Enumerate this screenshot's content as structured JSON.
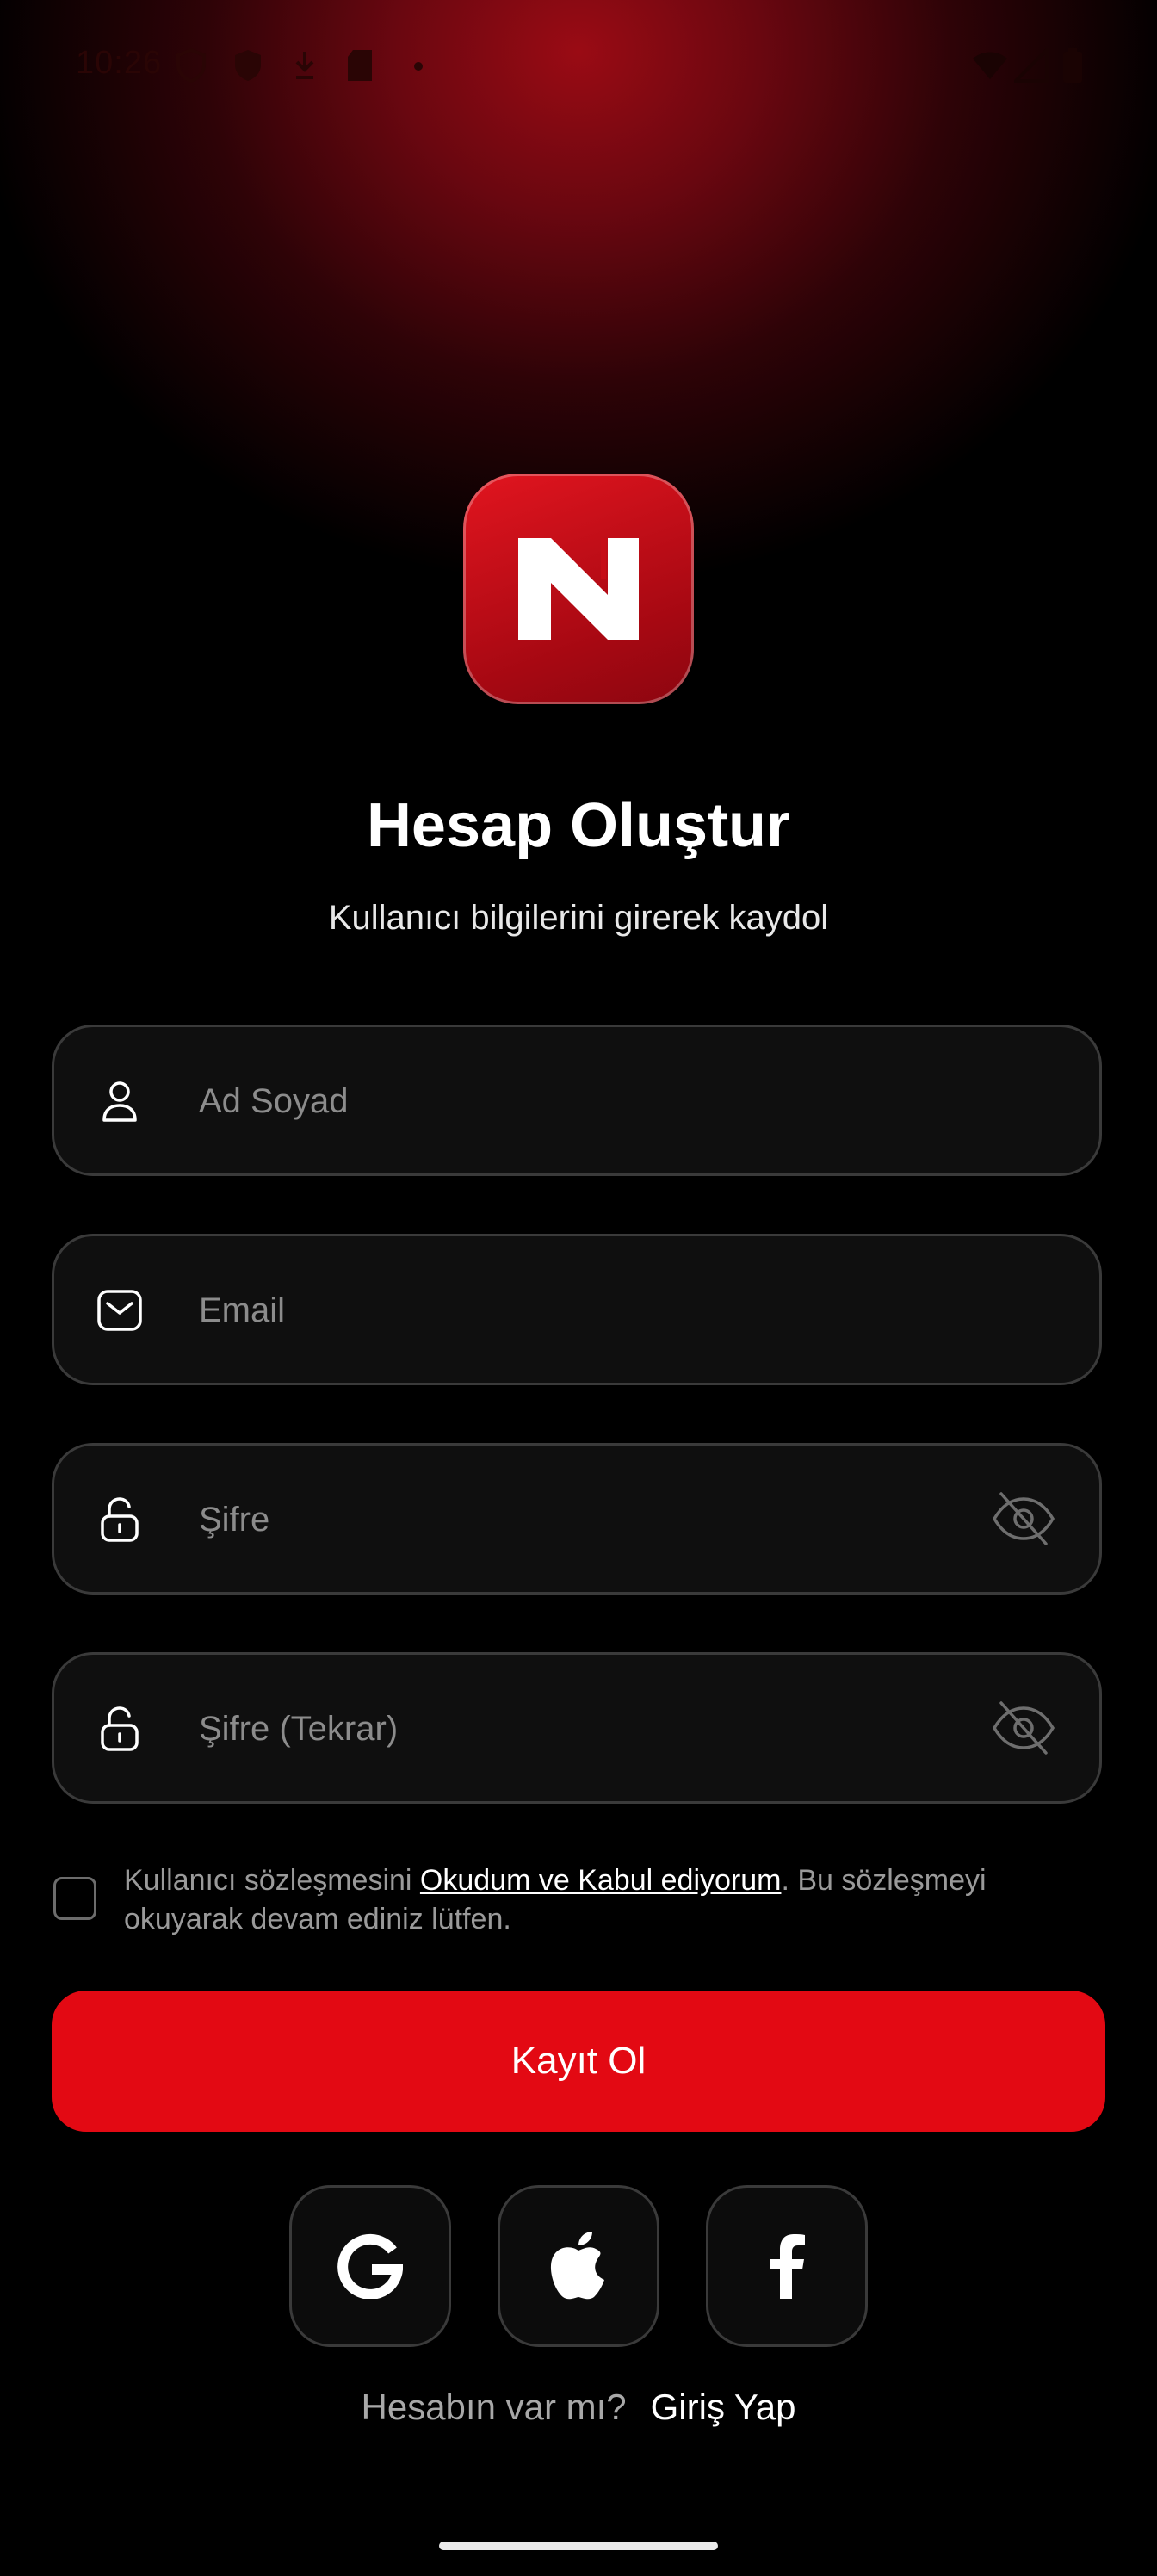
{
  "status_bar": {
    "time": "10:26",
    "icons": [
      "shield-icon",
      "vpn-icon",
      "download-icon",
      "sd-card-icon",
      "dot-icon",
      "wifi-icon",
      "signal-icon",
      "battery-icon"
    ]
  },
  "logo": {
    "icon": "brand-logo-icon",
    "accent": "#e30913"
  },
  "header": {
    "title": "Hesap Oluştur",
    "subtitle": "Kullanıcı bilgilerini girerek kaydol"
  },
  "form": {
    "name": {
      "placeholder": "Ad Soyad",
      "value": "",
      "icon": "user-icon"
    },
    "email": {
      "placeholder": "Email",
      "value": "",
      "icon": "mail-icon"
    },
    "password": {
      "placeholder": "Şifre",
      "value": "",
      "icon": "unlock-icon",
      "toggle_icon": "eye-off-icon"
    },
    "password_confirm": {
      "placeholder": "Şifre (Tekrar)",
      "value": "",
      "icon": "unlock-icon",
      "toggle_icon": "eye-off-icon"
    }
  },
  "terms": {
    "checked": false,
    "prefix": "Kullanıcı sözleşmesini ",
    "link": "Okudum ve Kabul ediyorum",
    "suffix": ". Bu sözleşmeyi okuyarak devam ediniz lütfen."
  },
  "submit_label": "Kayıt Ol",
  "social_buttons": [
    "google-icon",
    "apple-icon",
    "facebook-icon"
  ],
  "login_prompt": {
    "question": "Hesabın var mı?",
    "link": "Giriş Yap"
  }
}
